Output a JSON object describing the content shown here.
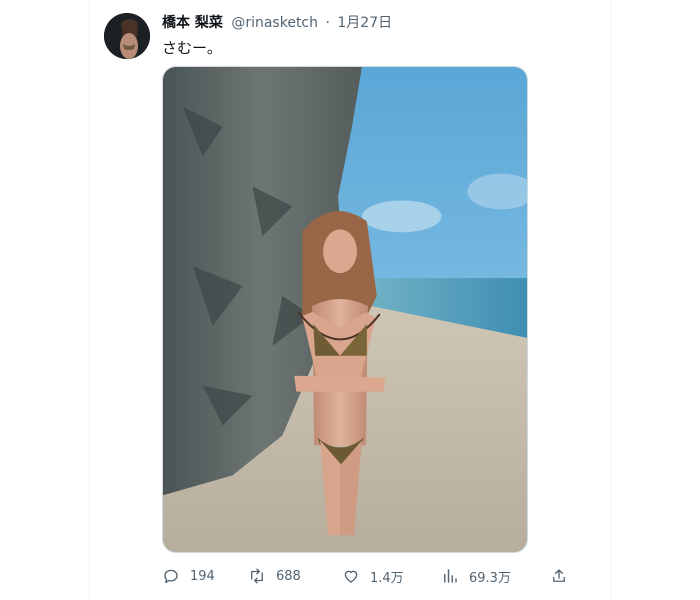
{
  "post": {
    "author_name": "橋本 梨菜",
    "handle": "@rinasketch",
    "separator": "·",
    "date": "1月27日",
    "text": "さむー。"
  },
  "actions": {
    "replies": "194",
    "retweets": "688",
    "likes": "1.4万",
    "views": "69.3万"
  },
  "icons": {
    "reply": "reply-icon",
    "retweet": "retweet-icon",
    "like": "heart-icon",
    "views": "analytics-icon",
    "share": "share-icon"
  },
  "colors": {
    "text_primary": "#0f1419",
    "text_secondary": "#536471",
    "border": "#cfd9de"
  }
}
